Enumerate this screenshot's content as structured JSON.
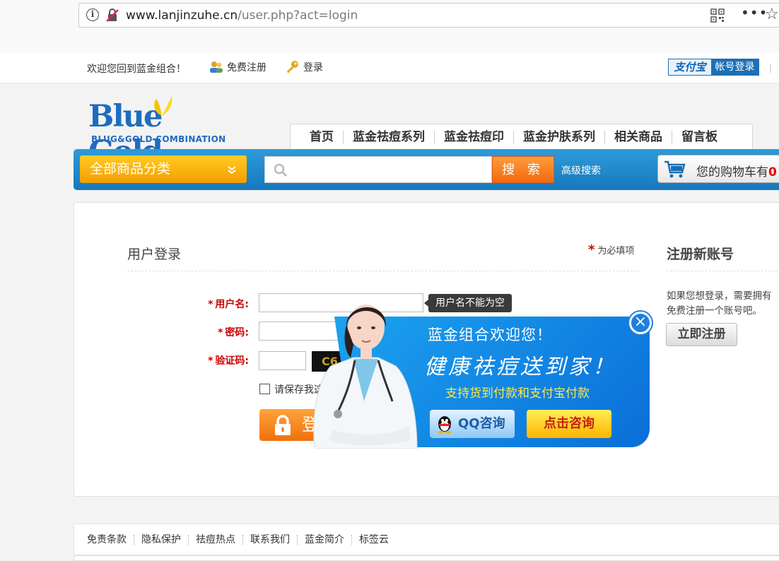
{
  "browser": {
    "url_host": "www.lanjinzuhe.cn",
    "url_path": "/user.php?act=login",
    "more_label": "•••",
    "star_label": "☆"
  },
  "topbar": {
    "welcome": "欢迎您回到蓝金组合！",
    "register": "免费注册",
    "login": "登录",
    "alipay_brand": "支付宝",
    "alipay_label": "帐号登录",
    "separator": "|"
  },
  "header": {
    "logo_text": "Blue Gold",
    "logo_sub": "BLUG&GOLD COMBINATION",
    "nav": [
      "首页",
      "蓝金祛痘系列",
      "蓝金祛痘印",
      "蓝金护肤系列",
      "相关商品",
      "留言板"
    ],
    "all_categories": "全部商品分类",
    "search_button": "搜 索",
    "advanced_search": "高级搜索",
    "cart_text": "您的购物车有",
    "cart_count": "0"
  },
  "login": {
    "title": "用户登录",
    "required_star": "*",
    "required_note": "为必填项",
    "username_label": "用户名:",
    "password_label": "密码:",
    "captcha_label": "验证码:",
    "captcha_text": "C6",
    "username_tip": "用户名不能为空",
    "remember": "请保存我这次",
    "login_button": "登"
  },
  "register": {
    "title": "注册新账号",
    "desc_line1": "如果您想登录，需要拥有",
    "desc_line2": "免费注册一个账号吧。",
    "button": "立即注册"
  },
  "popup": {
    "line1": "蓝金组合欢迎您！",
    "line2": "健康祛痘送到家！",
    "line3": "支持货到付款和支付宝付款",
    "qq_button": "QQ咨询",
    "consult_button": "点击咨询",
    "close": "×"
  },
  "footer": {
    "links": [
      "免责条款",
      "隐私保护",
      "祛痘热点",
      "联系我们",
      "蓝金简介",
      "标签云"
    ]
  },
  "colors": {
    "brand_blue": "#1e6cc0",
    "search_bar_blue": "#1678bd",
    "orange": "#f26a0d",
    "required_red": "#cc0000"
  }
}
